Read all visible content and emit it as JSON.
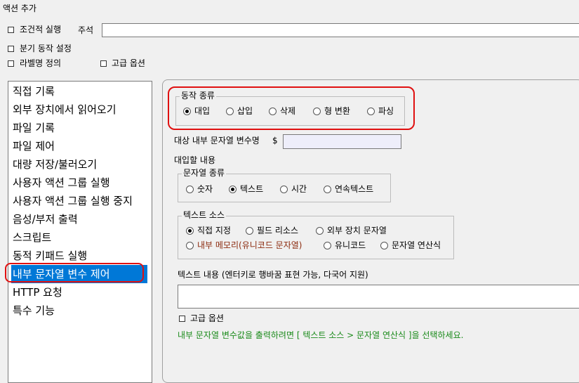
{
  "window": {
    "title": "액션 추가"
  },
  "top": {
    "conditional_exec": "조건적 실행",
    "comment_label": "주석",
    "comment_value": "",
    "branch_setting": "분기 동작 설정",
    "label_define": "라벨명 정의",
    "advanced_options": "고급 옵션"
  },
  "action_list": [
    "직접 기록",
    "외부 장치에서 읽어오기",
    "파일 기록",
    "파일 제어",
    "대량 저장/불러오기",
    "사용자 액션 그룹 실행",
    "사용자 액션 그룹 실행 중지",
    "음성/부저 출력",
    "스크립트",
    "동적 키패드 실행",
    "내부 문자열 변수 제어",
    "HTTP 요청",
    "특수 기능"
  ],
  "selected_action_index": 10,
  "op_type": {
    "title": "동작 종류",
    "options": [
      "대입",
      "삽입",
      "삭제",
      "형 변환",
      "파싱"
    ],
    "selected": "대입"
  },
  "target_var": {
    "label": "대상 내부 문자열 변수명",
    "dollar": "$",
    "value": ""
  },
  "assign_content": {
    "label": "대입할 내용"
  },
  "string_type": {
    "title": "문자열 종류",
    "options": [
      "숫자",
      "텍스트",
      "시간",
      "연속텍스트"
    ],
    "selected": "텍스트"
  },
  "text_source": {
    "title": "텍스트 소스",
    "options": [
      "직접 지정",
      "필드 리소스",
      "외부 장치 문자열",
      "내부 메모리(유니코드 문자열)",
      "유니코드",
      "문자열 연산식"
    ],
    "selected": "직접 지정",
    "highlight_color": "#8b2a0e"
  },
  "text_content": {
    "label": "텍스트 내용 (엔터키로 행바꿈 표현 가능, 다국어 지원)",
    "value": ""
  },
  "bottom": {
    "advanced_options": "고급 옵션",
    "hint": "내부 문자열 변수값을 출력하려면 [ 텍스트 소스 > 문자열 연산식 ]을 선택하세요.",
    "hint_color": "#1a8a1a"
  }
}
